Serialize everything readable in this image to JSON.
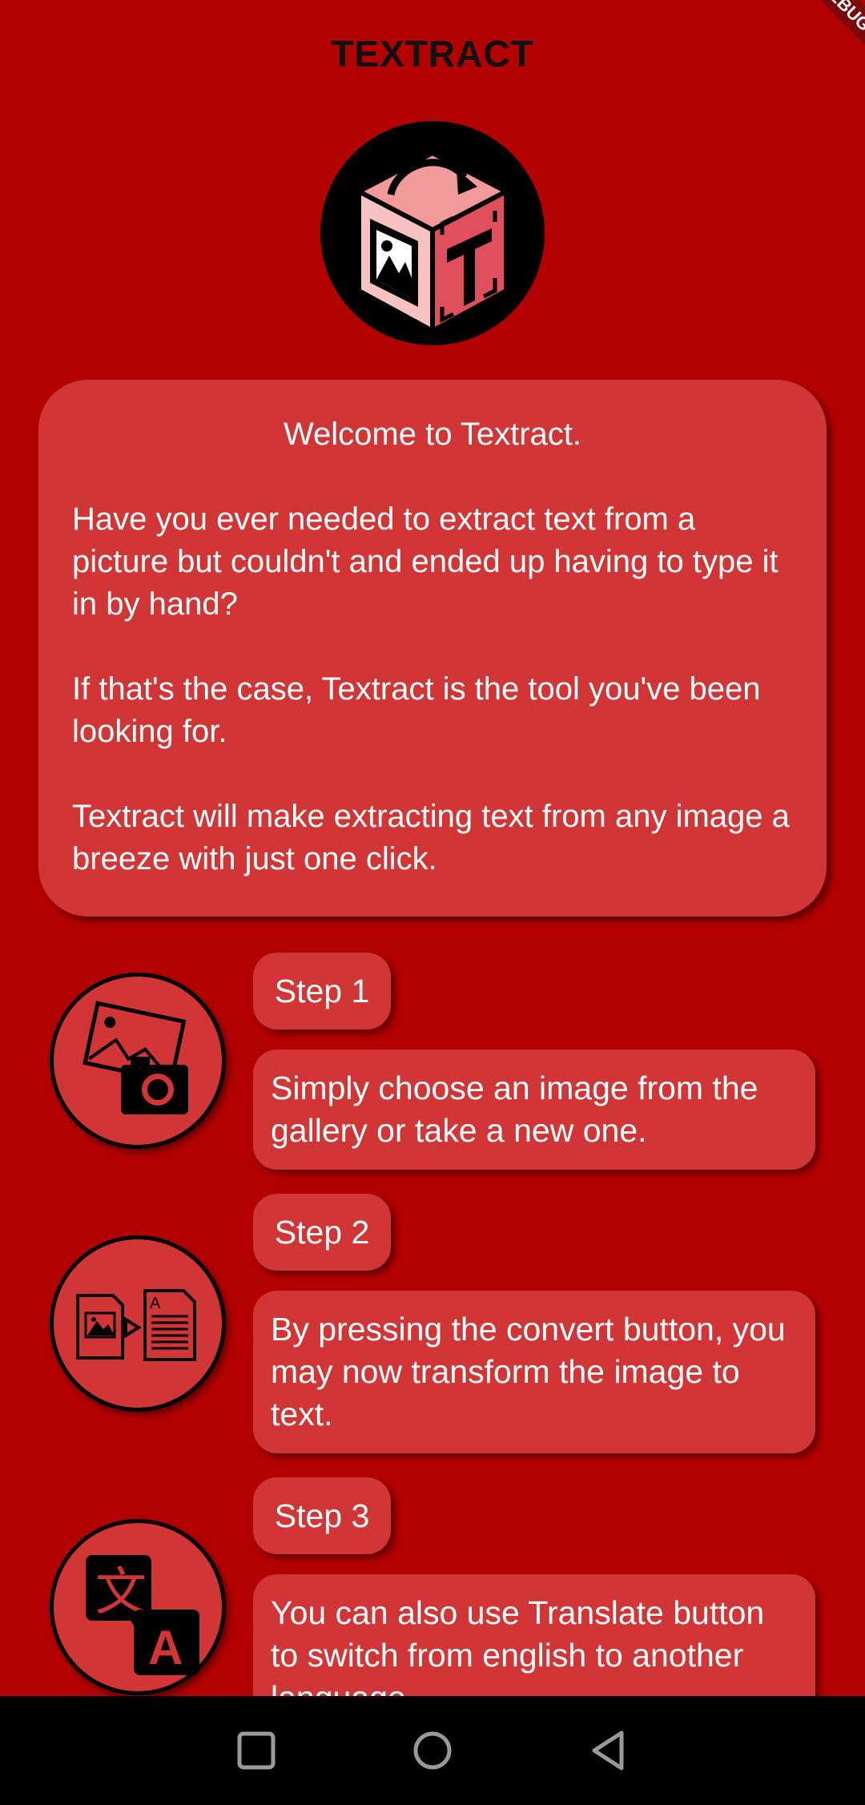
{
  "app": {
    "title": "TEXTRACT",
    "debug_banner": "DEBUG"
  },
  "welcome": {
    "title": "Welcome to Textract.",
    "paragraphs": [
      "Have you ever needed to extract text from a picture but couldn't and ended up having to type it in by hand?",
      "If that's the case, Textract is the tool you've been looking for.",
      "Textract will make extracting text from any image a breeze with just one click."
    ]
  },
  "steps": [
    {
      "label": "Step 1",
      "icon": "image-camera-icon",
      "text": "Simply choose an image from the gallery or take a new one."
    },
    {
      "label": "Step 2",
      "icon": "image-to-text-icon",
      "text": "By pressing the convert button, you may now transform the image to text."
    },
    {
      "label": "Step 3",
      "icon": "translate-icon",
      "text": "You can also use Translate button to switch from english to another language."
    }
  ],
  "navbar": {
    "icons": [
      "recent-apps-icon",
      "home-icon",
      "back-icon"
    ]
  },
  "colors": {
    "background": "#B30000",
    "card": "#D13535",
    "text": "#FFFFFF",
    "title": "#111111"
  }
}
